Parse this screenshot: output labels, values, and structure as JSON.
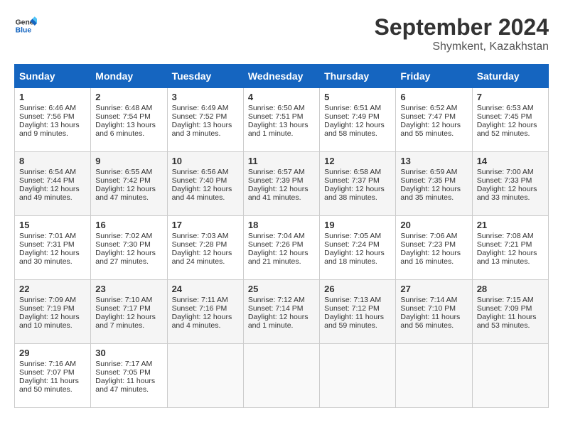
{
  "header": {
    "logo_line1": "General",
    "logo_line2": "Blue",
    "month": "September 2024",
    "location": "Shymkent, Kazakhstan"
  },
  "days_of_week": [
    "Sunday",
    "Monday",
    "Tuesday",
    "Wednesday",
    "Thursday",
    "Friday",
    "Saturday"
  ],
  "weeks": [
    [
      {
        "day": "1",
        "sunrise": "Sunrise: 6:46 AM",
        "sunset": "Sunset: 7:56 PM",
        "daylight": "Daylight: 13 hours and 9 minutes."
      },
      {
        "day": "2",
        "sunrise": "Sunrise: 6:48 AM",
        "sunset": "Sunset: 7:54 PM",
        "daylight": "Daylight: 13 hours and 6 minutes."
      },
      {
        "day": "3",
        "sunrise": "Sunrise: 6:49 AM",
        "sunset": "Sunset: 7:52 PM",
        "daylight": "Daylight: 13 hours and 3 minutes."
      },
      {
        "day": "4",
        "sunrise": "Sunrise: 6:50 AM",
        "sunset": "Sunset: 7:51 PM",
        "daylight": "Daylight: 13 hours and 1 minute."
      },
      {
        "day": "5",
        "sunrise": "Sunrise: 6:51 AM",
        "sunset": "Sunset: 7:49 PM",
        "daylight": "Daylight: 12 hours and 58 minutes."
      },
      {
        "day": "6",
        "sunrise": "Sunrise: 6:52 AM",
        "sunset": "Sunset: 7:47 PM",
        "daylight": "Daylight: 12 hours and 55 minutes."
      },
      {
        "day": "7",
        "sunrise": "Sunrise: 6:53 AM",
        "sunset": "Sunset: 7:45 PM",
        "daylight": "Daylight: 12 hours and 52 minutes."
      }
    ],
    [
      {
        "day": "8",
        "sunrise": "Sunrise: 6:54 AM",
        "sunset": "Sunset: 7:44 PM",
        "daylight": "Daylight: 12 hours and 49 minutes."
      },
      {
        "day": "9",
        "sunrise": "Sunrise: 6:55 AM",
        "sunset": "Sunset: 7:42 PM",
        "daylight": "Daylight: 12 hours and 47 minutes."
      },
      {
        "day": "10",
        "sunrise": "Sunrise: 6:56 AM",
        "sunset": "Sunset: 7:40 PM",
        "daylight": "Daylight: 12 hours and 44 minutes."
      },
      {
        "day": "11",
        "sunrise": "Sunrise: 6:57 AM",
        "sunset": "Sunset: 7:39 PM",
        "daylight": "Daylight: 12 hours and 41 minutes."
      },
      {
        "day": "12",
        "sunrise": "Sunrise: 6:58 AM",
        "sunset": "Sunset: 7:37 PM",
        "daylight": "Daylight: 12 hours and 38 minutes."
      },
      {
        "day": "13",
        "sunrise": "Sunrise: 6:59 AM",
        "sunset": "Sunset: 7:35 PM",
        "daylight": "Daylight: 12 hours and 35 minutes."
      },
      {
        "day": "14",
        "sunrise": "Sunrise: 7:00 AM",
        "sunset": "Sunset: 7:33 PM",
        "daylight": "Daylight: 12 hours and 33 minutes."
      }
    ],
    [
      {
        "day": "15",
        "sunrise": "Sunrise: 7:01 AM",
        "sunset": "Sunset: 7:31 PM",
        "daylight": "Daylight: 12 hours and 30 minutes."
      },
      {
        "day": "16",
        "sunrise": "Sunrise: 7:02 AM",
        "sunset": "Sunset: 7:30 PM",
        "daylight": "Daylight: 12 hours and 27 minutes."
      },
      {
        "day": "17",
        "sunrise": "Sunrise: 7:03 AM",
        "sunset": "Sunset: 7:28 PM",
        "daylight": "Daylight: 12 hours and 24 minutes."
      },
      {
        "day": "18",
        "sunrise": "Sunrise: 7:04 AM",
        "sunset": "Sunset: 7:26 PM",
        "daylight": "Daylight: 12 hours and 21 minutes."
      },
      {
        "day": "19",
        "sunrise": "Sunrise: 7:05 AM",
        "sunset": "Sunset: 7:24 PM",
        "daylight": "Daylight: 12 hours and 18 minutes."
      },
      {
        "day": "20",
        "sunrise": "Sunrise: 7:06 AM",
        "sunset": "Sunset: 7:23 PM",
        "daylight": "Daylight: 12 hours and 16 minutes."
      },
      {
        "day": "21",
        "sunrise": "Sunrise: 7:08 AM",
        "sunset": "Sunset: 7:21 PM",
        "daylight": "Daylight: 12 hours and 13 minutes."
      }
    ],
    [
      {
        "day": "22",
        "sunrise": "Sunrise: 7:09 AM",
        "sunset": "Sunset: 7:19 PM",
        "daylight": "Daylight: 12 hours and 10 minutes."
      },
      {
        "day": "23",
        "sunrise": "Sunrise: 7:10 AM",
        "sunset": "Sunset: 7:17 PM",
        "daylight": "Daylight: 12 hours and 7 minutes."
      },
      {
        "day": "24",
        "sunrise": "Sunrise: 7:11 AM",
        "sunset": "Sunset: 7:16 PM",
        "daylight": "Daylight: 12 hours and 4 minutes."
      },
      {
        "day": "25",
        "sunrise": "Sunrise: 7:12 AM",
        "sunset": "Sunset: 7:14 PM",
        "daylight": "Daylight: 12 hours and 1 minute."
      },
      {
        "day": "26",
        "sunrise": "Sunrise: 7:13 AM",
        "sunset": "Sunset: 7:12 PM",
        "daylight": "Daylight: 11 hours and 59 minutes."
      },
      {
        "day": "27",
        "sunrise": "Sunrise: 7:14 AM",
        "sunset": "Sunset: 7:10 PM",
        "daylight": "Daylight: 11 hours and 56 minutes."
      },
      {
        "day": "28",
        "sunrise": "Sunrise: 7:15 AM",
        "sunset": "Sunset: 7:09 PM",
        "daylight": "Daylight: 11 hours and 53 minutes."
      }
    ],
    [
      {
        "day": "29",
        "sunrise": "Sunrise: 7:16 AM",
        "sunset": "Sunset: 7:07 PM",
        "daylight": "Daylight: 11 hours and 50 minutes."
      },
      {
        "day": "30",
        "sunrise": "Sunrise: 7:17 AM",
        "sunset": "Sunset: 7:05 PM",
        "daylight": "Daylight: 11 hours and 47 minutes."
      },
      null,
      null,
      null,
      null,
      null
    ]
  ]
}
